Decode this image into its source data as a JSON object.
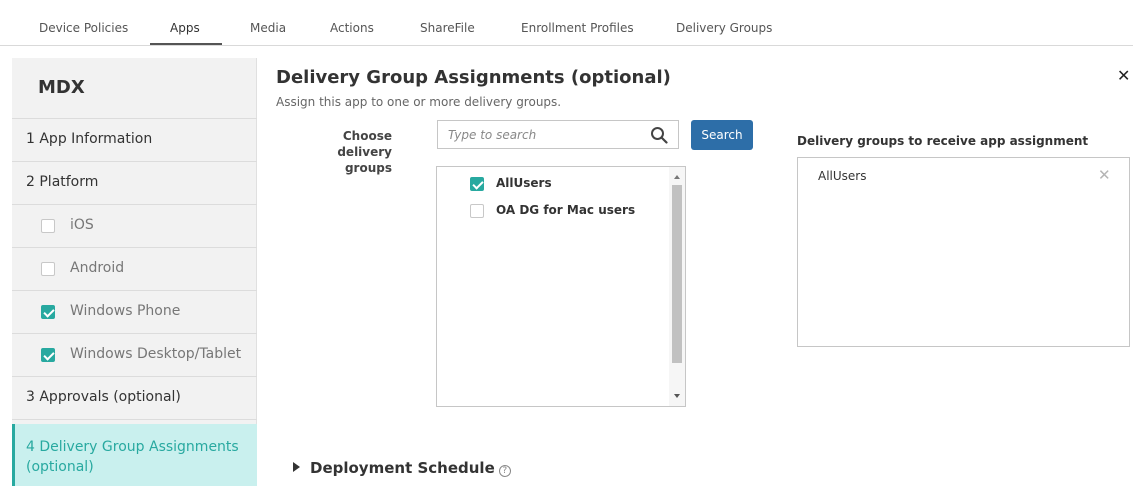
{
  "tabs": [
    {
      "label": "Device Policies",
      "active": false
    },
    {
      "label": "Apps",
      "active": true
    },
    {
      "label": "Media",
      "active": false
    },
    {
      "label": "Actions",
      "active": false
    },
    {
      "label": "ShareFile",
      "active": false
    },
    {
      "label": "Enrollment Profiles",
      "active": false
    },
    {
      "label": "Delivery Groups",
      "active": false
    }
  ],
  "sidebar": {
    "title": "MDX",
    "items": [
      {
        "label": "1 App Information"
      },
      {
        "label": "2 Platform"
      },
      {
        "label": "iOS",
        "checked": false
      },
      {
        "label": "Android",
        "checked": false
      },
      {
        "label": "Windows Phone",
        "checked": true
      },
      {
        "label": "Windows Desktop/Tablet",
        "checked": true
      },
      {
        "label": "3 Approvals (optional)"
      },
      {
        "label": "4 Delivery Group Assignments (optional)",
        "active": true
      }
    ]
  },
  "main": {
    "title": "Delivery Group Assignments (optional)",
    "subtitle": "Assign this app to one or more delivery groups.",
    "close_icon": "close-icon",
    "choose_label": "Choose delivery groups",
    "search": {
      "placeholder": "Type to search",
      "value": "",
      "button_label": "Search"
    },
    "groups": [
      {
        "label": "AllUsers",
        "checked": true
      },
      {
        "label": "OA DG for Mac users",
        "checked": false
      }
    ],
    "receive_label": "Delivery groups to receive app assignment",
    "selected_groups": [
      {
        "label": "AllUsers"
      }
    ],
    "deployment_schedule": "Deployment Schedule"
  },
  "colors": {
    "accent": "#28a9a0",
    "button": "#2d6ea8",
    "active_bg": "#c9f0ee"
  }
}
